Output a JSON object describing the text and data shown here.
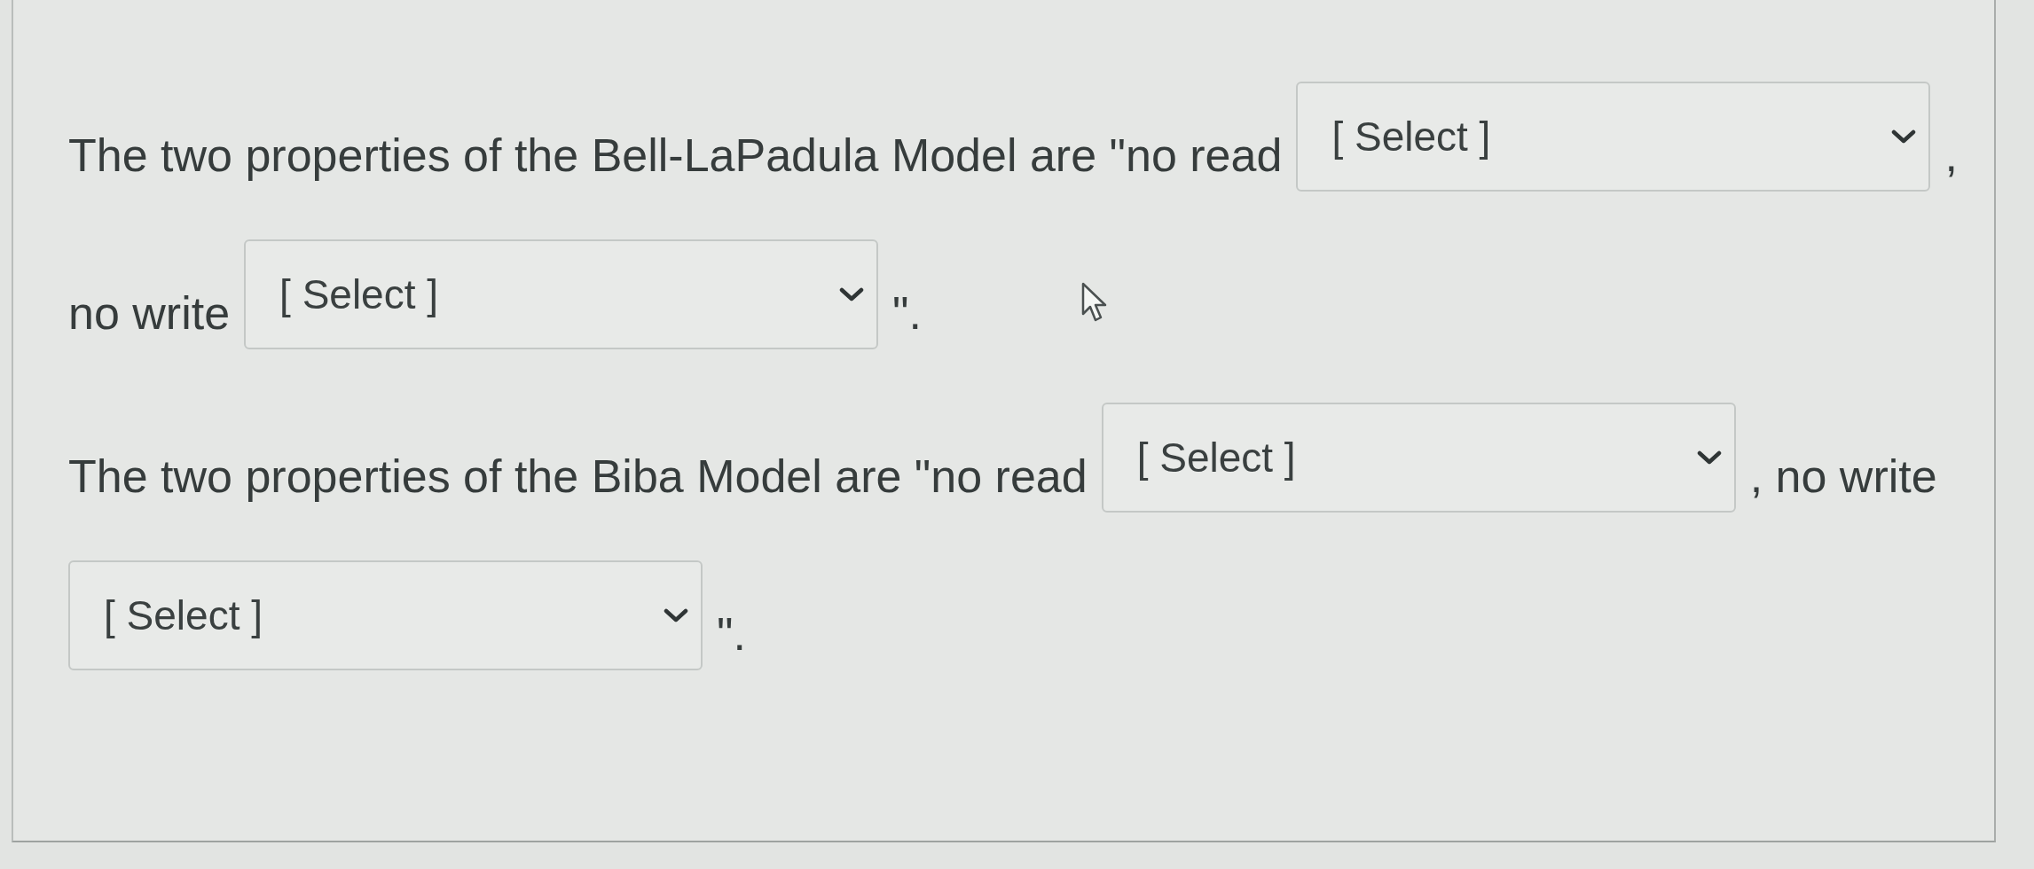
{
  "questions": [
    {
      "lines": [
        {
          "parts": [
            {
              "kind": "text",
              "text": "The two properties of the Bell-LaPadula Model are \"no read"
            },
            {
              "kind": "select",
              "value": "[ Select ]"
            },
            {
              "kind": "text",
              "text": ","
            }
          ]
        },
        {
          "parts": [
            {
              "kind": "text",
              "text": "no write"
            },
            {
              "kind": "select",
              "value": "[ Select ]"
            },
            {
              "kind": "text",
              "text": "\"."
            }
          ]
        }
      ]
    },
    {
      "lines": [
        {
          "parts": [
            {
              "kind": "text",
              "text": "The two properties of the Biba Model are \"no read"
            },
            {
              "kind": "select",
              "value": "[ Select ]"
            },
            {
              "kind": "text",
              "text": ", no write"
            }
          ]
        },
        {
          "parts": [
            {
              "kind": "select",
              "value": "[ Select ]"
            },
            {
              "kind": "text",
              "text": "\"."
            }
          ]
        }
      ]
    }
  ]
}
